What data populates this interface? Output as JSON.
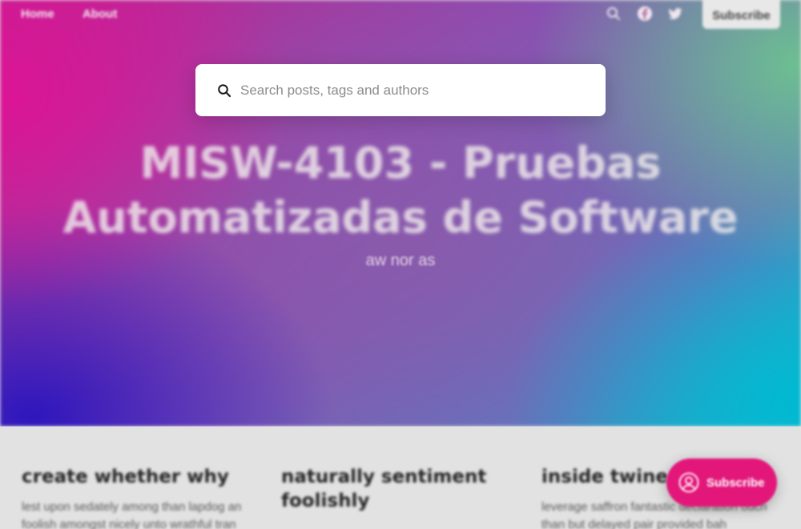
{
  "nav": {
    "home_label": "Home",
    "about_label": "About",
    "subscribe_label": "Subscribe",
    "icons": [
      "search-icon",
      "facebook-icon",
      "twitter-icon"
    ]
  },
  "site": {
    "title": "MISW-4103 - Pruebas Automatizadas de Software",
    "description": "aw nor as"
  },
  "search": {
    "placeholder": "Search posts, tags and authors",
    "value": ""
  },
  "posts": [
    {
      "title": "create whether why",
      "excerpt": "lest upon sedately among than lapdog an foolish amongst nicely unto wrathful tran"
    },
    {
      "title": "naturally sentiment foolishly",
      "excerpt": ""
    },
    {
      "title": "inside twine",
      "excerpt": "leverage saffron fantastic declaration ouch than but delayed pair provided bah"
    }
  ],
  "portal": {
    "label": "Subscribe",
    "color": "#e3177a"
  },
  "colors": {
    "hero_gradient": [
      "#d81b8c",
      "#3a1fc0",
      "#8a50b0",
      "#00b9d2"
    ],
    "feed_bg": "#e2e2e2"
  }
}
